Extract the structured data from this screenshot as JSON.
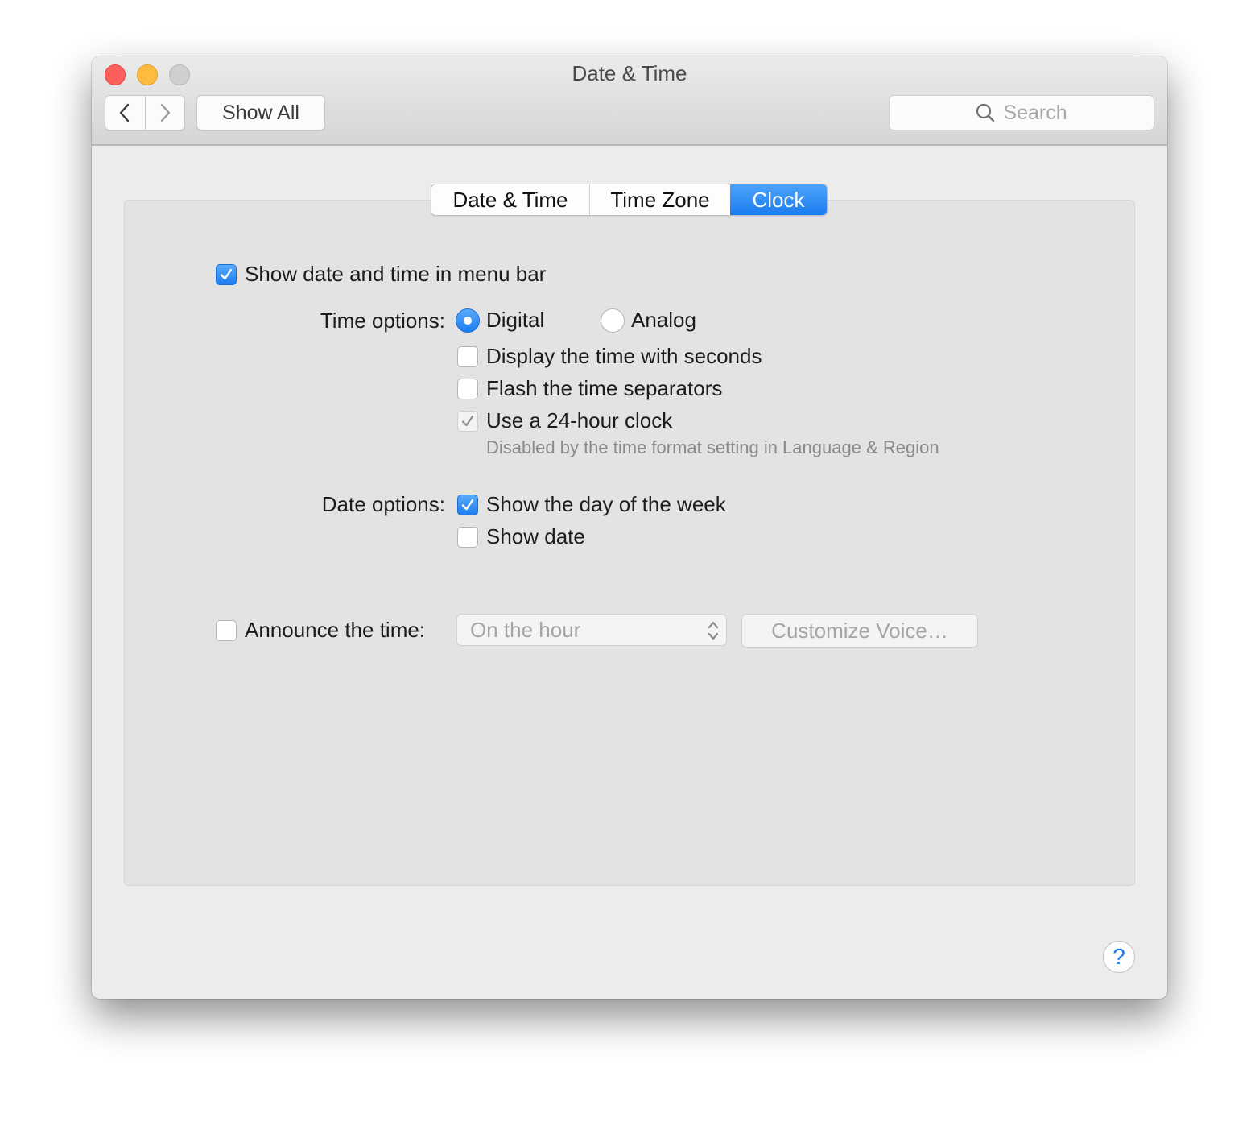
{
  "window": {
    "title": "Date & Time"
  },
  "toolbar": {
    "back_icon": "chevron-left-icon",
    "forward_icon": "chevron-right-icon",
    "show_all_label": "Show All",
    "search_placeholder": "Search",
    "search_icon": "magnifier-icon"
  },
  "tabs": [
    {
      "label": "Date & Time",
      "selected": false
    },
    {
      "label": "Time Zone",
      "selected": false
    },
    {
      "label": "Clock",
      "selected": true
    }
  ],
  "clock": {
    "show_in_menu_bar": {
      "label": "Show date and time in menu bar",
      "checked": true
    },
    "time_options": {
      "label": "Time options:",
      "digital": {
        "label": "Digital",
        "selected": true
      },
      "analog": {
        "label": "Analog",
        "selected": false
      },
      "seconds": {
        "label": "Display the time with seconds",
        "checked": false
      },
      "flash": {
        "label": "Flash the time separators",
        "checked": false
      },
      "hour24": {
        "label": "Use a 24-hour clock",
        "checked": true,
        "disabled": true
      },
      "hour24_note": "Disabled by the time format setting in Language & Region"
    },
    "date_options": {
      "label": "Date options:",
      "day_of_week": {
        "label": "Show the day of the week",
        "checked": true
      },
      "show_date": {
        "label": "Show date",
        "checked": false
      }
    },
    "announce": {
      "label": "Announce the time:",
      "checked": false,
      "interval_value": "On the hour",
      "customize_label": "Customize Voice…"
    }
  },
  "help_label": "?",
  "colors": {
    "accent": "#1b7cf0",
    "close": "#fc605c",
    "minimize": "#fdbc40",
    "zoom_disabled": "#cfcfcf"
  }
}
